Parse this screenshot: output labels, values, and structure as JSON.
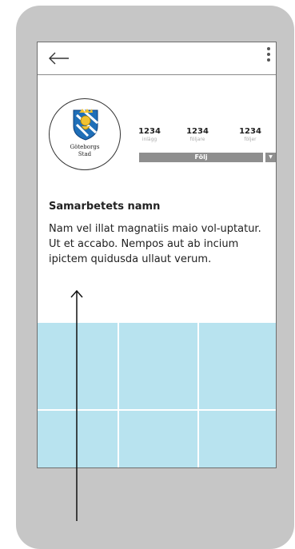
{
  "profile": {
    "avatar_text_line1": "Göteborgs",
    "avatar_text_line2": "Stad",
    "stats": [
      {
        "value": "1234",
        "label": "inlägg"
      },
      {
        "value": "1234",
        "label": "följare"
      },
      {
        "value": "1234",
        "label": "följer"
      }
    ],
    "follow_label": "Följ",
    "dropdown_glyph": "▼",
    "name": "Samarbetets namn",
    "bio": "Nam vel illat magnatiis maio vol-uptatur. Ut et accabo. Nempos aut ab incium ipictem quidusda ullaut verum."
  },
  "icons": {
    "back": "back-arrow-icon",
    "menu": "more-vertical-icon",
    "crest": "goteborg-crest-logo",
    "pointer": "annotation-arrow-up"
  },
  "colors": {
    "device": "#c6c6c6",
    "button": "#8e8e8e",
    "grid_tile": "#b8e3ef",
    "text": "#222222",
    "muted_text": "#aaaaaa"
  }
}
